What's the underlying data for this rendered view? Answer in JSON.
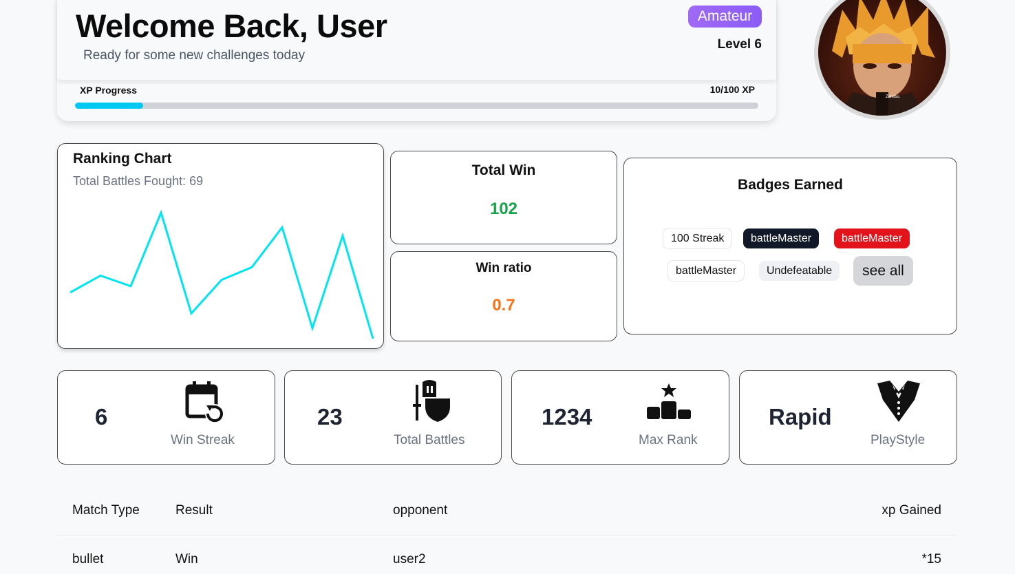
{
  "header": {
    "title": "Welcome Back, User",
    "subtitle": "Ready for some new challenges today",
    "rank": "Amateur",
    "level": "Level 6",
    "xp_label": "XP Progress",
    "xp_value": "10/100 XP",
    "xp_fraction": 0.1
  },
  "avatar": {
    "caption": "Zenitsu."
  },
  "ranking": {
    "title": "Ranking Chart",
    "subtitle": "Total Battles Fought: 69"
  },
  "chart_data": {
    "type": "line",
    "x": [
      1,
      2,
      3,
      4,
      5,
      6,
      7,
      8,
      9,
      10,
      11
    ],
    "values": [
      62,
      70,
      65,
      100,
      52,
      68,
      74,
      93,
      45,
      89,
      40
    ],
    "ylim": [
      40,
      100
    ],
    "color": "#00e5f0"
  },
  "total_win": {
    "title": "Total Win",
    "value": "102",
    "color": "#16a34a"
  },
  "win_ratio": {
    "title": "Win ratio",
    "value": "0.7",
    "color": "#f97316"
  },
  "badges": {
    "title": "Badges Earned",
    "items": [
      "100 Streak",
      "battleMaster",
      "battleMaster",
      "battleMaster",
      "Undefeatable"
    ],
    "see_all": "see all"
  },
  "stats": [
    {
      "value": "6",
      "label": "Win Streak",
      "icon": "calendar-refresh-icon"
    },
    {
      "value": "23",
      "label": "Total Battles",
      "icon": "knight-shield-icon"
    },
    {
      "value": "1234",
      "label": "Max Rank",
      "icon": "podium-star-icon"
    },
    {
      "value": "Rapid",
      "label": "PlayStyle",
      "icon": "tuxedo-icon"
    }
  ],
  "matches": {
    "columns": [
      "Match Type",
      "Result",
      "opponent",
      "xp Gained"
    ],
    "rows": [
      [
        "bullet",
        "Win",
        "user2",
        "*15"
      ]
    ]
  }
}
